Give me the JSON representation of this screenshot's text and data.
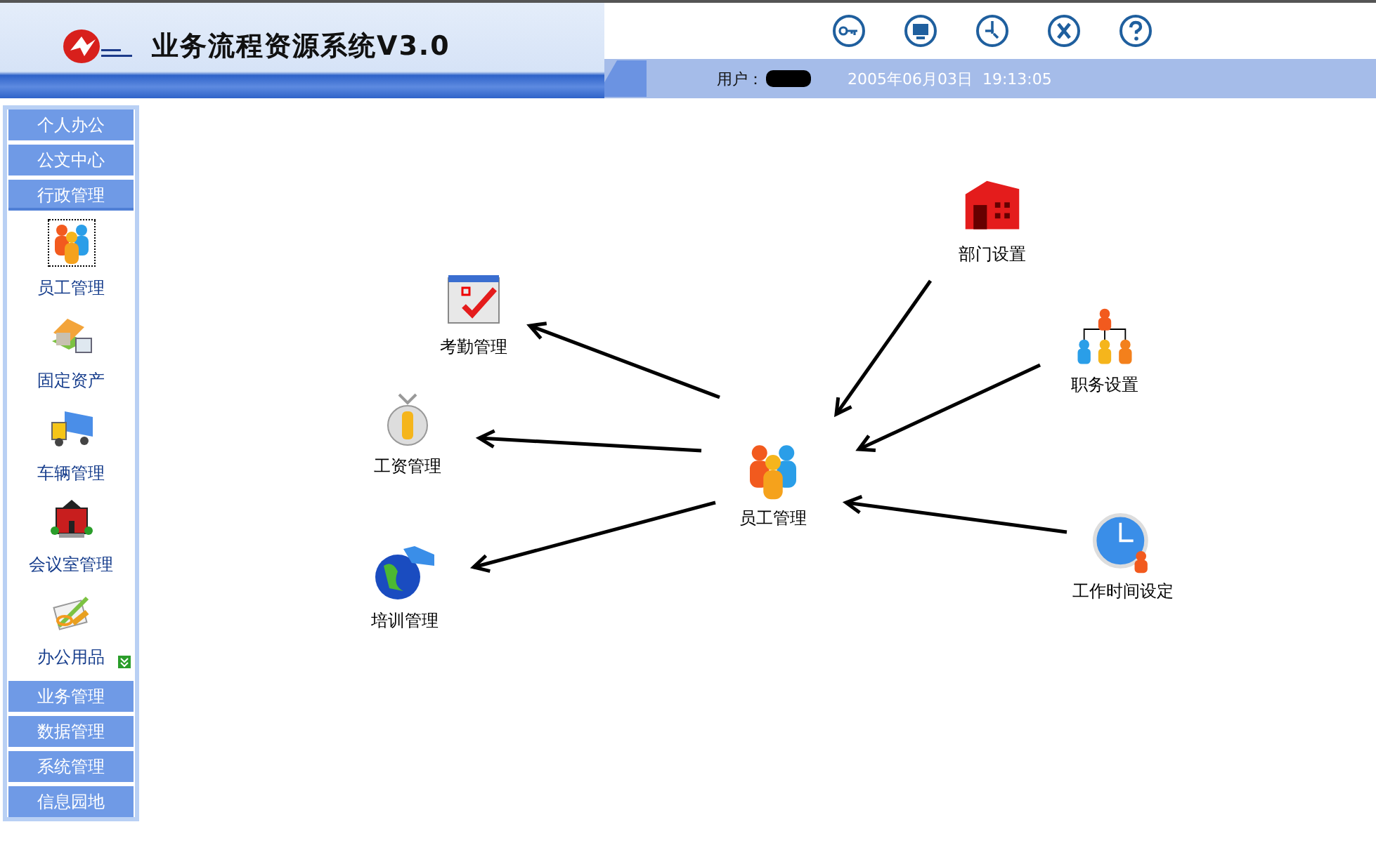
{
  "header": {
    "title": "业务流程资源系统V3.0",
    "user_label": "用户：",
    "datetime": "2005年06月03日  19:13:05"
  },
  "sidebar": {
    "sections": [
      {
        "label": "个人办公",
        "expanded": false
      },
      {
        "label": "公文中心",
        "expanded": false
      },
      {
        "label": "行政管理",
        "expanded": true,
        "items": [
          {
            "label": "员工管理",
            "kind": "people",
            "selected": true
          },
          {
            "label": "固定资产",
            "kind": "house",
            "selected": false
          },
          {
            "label": "车辆管理",
            "kind": "truck",
            "selected": false
          },
          {
            "label": "会议室管理",
            "kind": "hall",
            "selected": false
          },
          {
            "label": "办公用品",
            "kind": "supplies",
            "selected": false
          }
        ]
      },
      {
        "label": "业务管理",
        "expanded": false
      },
      {
        "label": "数据管理",
        "expanded": false
      },
      {
        "label": "系统管理",
        "expanded": false
      },
      {
        "label": "信息园地",
        "expanded": false
      }
    ]
  },
  "diagram": {
    "nodes": [
      {
        "label": "考勤管理",
        "kind": "calendar"
      },
      {
        "label": "工资管理",
        "kind": "moneybag"
      },
      {
        "label": "培训管理",
        "kind": "globe"
      },
      {
        "label": "员工管理",
        "kind": "people"
      },
      {
        "label": "部门设置",
        "kind": "building"
      },
      {
        "label": "职务设置",
        "kind": "orgchart"
      },
      {
        "label": "工作时间设定",
        "kind": "clock"
      }
    ]
  }
}
